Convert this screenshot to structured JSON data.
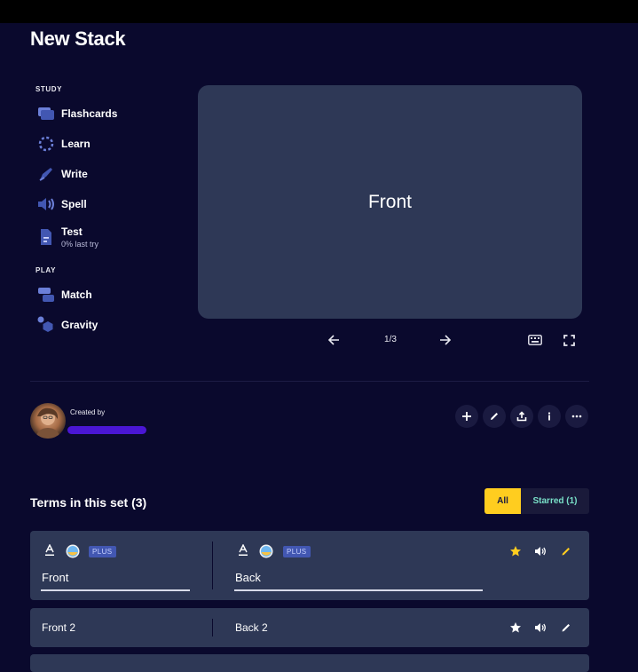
{
  "page": {
    "title": "New Stack"
  },
  "sidebar": {
    "study_label": "STUDY",
    "play_label": "PLAY",
    "study_items": [
      {
        "label": "Flashcards",
        "icon": "flashcards-icon"
      },
      {
        "label": "Learn",
        "icon": "learn-icon"
      },
      {
        "label": "Write",
        "icon": "write-icon"
      },
      {
        "label": "Spell",
        "icon": "spell-icon"
      },
      {
        "label": "Test",
        "sub": "0% last try",
        "icon": "test-icon"
      }
    ],
    "play_items": [
      {
        "label": "Match",
        "icon": "match-icon"
      },
      {
        "label": "Gravity",
        "icon": "gravity-icon"
      }
    ]
  },
  "flashcard": {
    "text": "Front",
    "counter": "1/3"
  },
  "creator": {
    "label": "Created by"
  },
  "terms": {
    "title": "Terms in this set (3)",
    "tab_all": "All",
    "tab_starred": "Starred (1)",
    "plus_badge": "PLUS",
    "rows": [
      {
        "front": "Front",
        "back": "Back"
      },
      {
        "front": "Front 2",
        "back": "Back 2"
      }
    ]
  },
  "colors": {
    "background": "#0a092d",
    "card": "#2e3856",
    "accent_yellow": "#ffcd1f",
    "accent_blue": "#4257b2",
    "creator_bar": "#4a16d4"
  }
}
